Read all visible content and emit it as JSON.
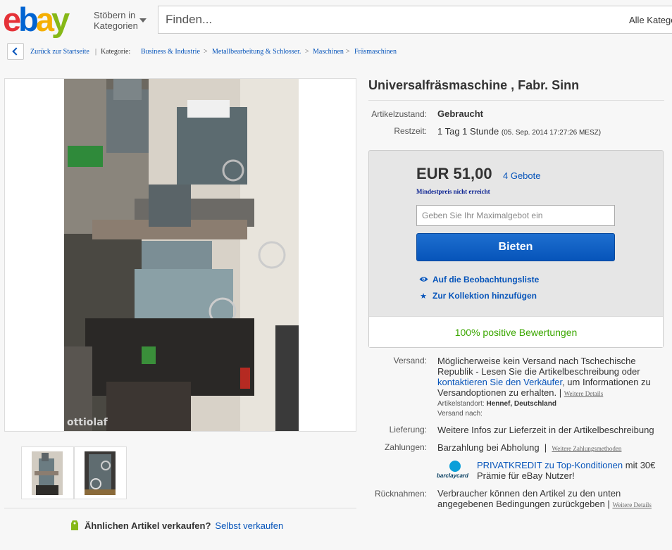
{
  "header": {
    "browse_line1": "Stöbern in",
    "browse_line2": "Kategorien",
    "search_placeholder": "Finden...",
    "category_select": "Alle Katego"
  },
  "breadcrumb": {
    "back_label": "Zurück zur Startseite",
    "category_label": "Kategorie:",
    "items": [
      "Business & Industrie",
      "Metallbearbeitung & Schlosser.",
      "Maschinen",
      "Fräsmaschinen"
    ]
  },
  "gallery": {
    "watermark": "ottiolaf"
  },
  "sell_prompt": {
    "question": "Ähnlichen Artikel verkaufen?",
    "link": "Selbst verkaufen"
  },
  "item": {
    "title": "Universalfräsmaschine , Fabr. Sinn",
    "condition_label": "Artikelzustand:",
    "condition_value": "Gebraucht",
    "time_label": "Restzeit:",
    "time_value": "1 Tag 1 Stunde",
    "time_end": "(05. Sep. 2014  17:27:26 MESZ)"
  },
  "bidding": {
    "price": "EUR 51,00",
    "bids": "4 Gebote",
    "reserve": "Mindestpreis nicht erreicht",
    "max_bid_placeholder": "Geben Sie Ihr Maximalgebot ein",
    "bid_button": "Bieten",
    "watch_label": "Auf die Beobachtungsliste",
    "collection_label": "Zur Kollektion hinzufügen",
    "feedback": "100% positive Bewertungen"
  },
  "shipping": {
    "label": "Versand:",
    "text_1": "Möglicherweise kein Versand nach Tschechische Republik - Lesen Sie die Artikelbeschreibung oder",
    "link": "kontaktieren Sie den Verkäufer",
    "text_2": ", um Informationen zu Versandoptionen zu erhalten. |",
    "more": "Weitere Details",
    "location_label": "Artikelstandort:",
    "location_value": "Hennef, Deutschland",
    "ships_to_label": "Versand nach:"
  },
  "delivery": {
    "label": "Lieferung:",
    "value": "Weitere Infos zur Lieferzeit in der Artikelbeschreibung"
  },
  "payment": {
    "label": "Zahlungen:",
    "value": "Barzahlung bei Abholung",
    "sep": "|",
    "more": "Weitere Zahlungsmethoden",
    "credit_link": "PRIVATKREDIT zu Top-Konditionen",
    "credit_text": " mit 30€ Prämie für eBay Nutzer!",
    "barclay_logo": "barclaycard"
  },
  "returns": {
    "label": "Rücknahmen:",
    "value": "Verbraucher können den Artikel zu den unten angegebenen Bedingungen zurückgeben |",
    "more": "Weitere Details"
  },
  "colors": {
    "link": "#0654ba",
    "feedback_green": "#3ba700",
    "reserve_blue": "#0c2392"
  }
}
